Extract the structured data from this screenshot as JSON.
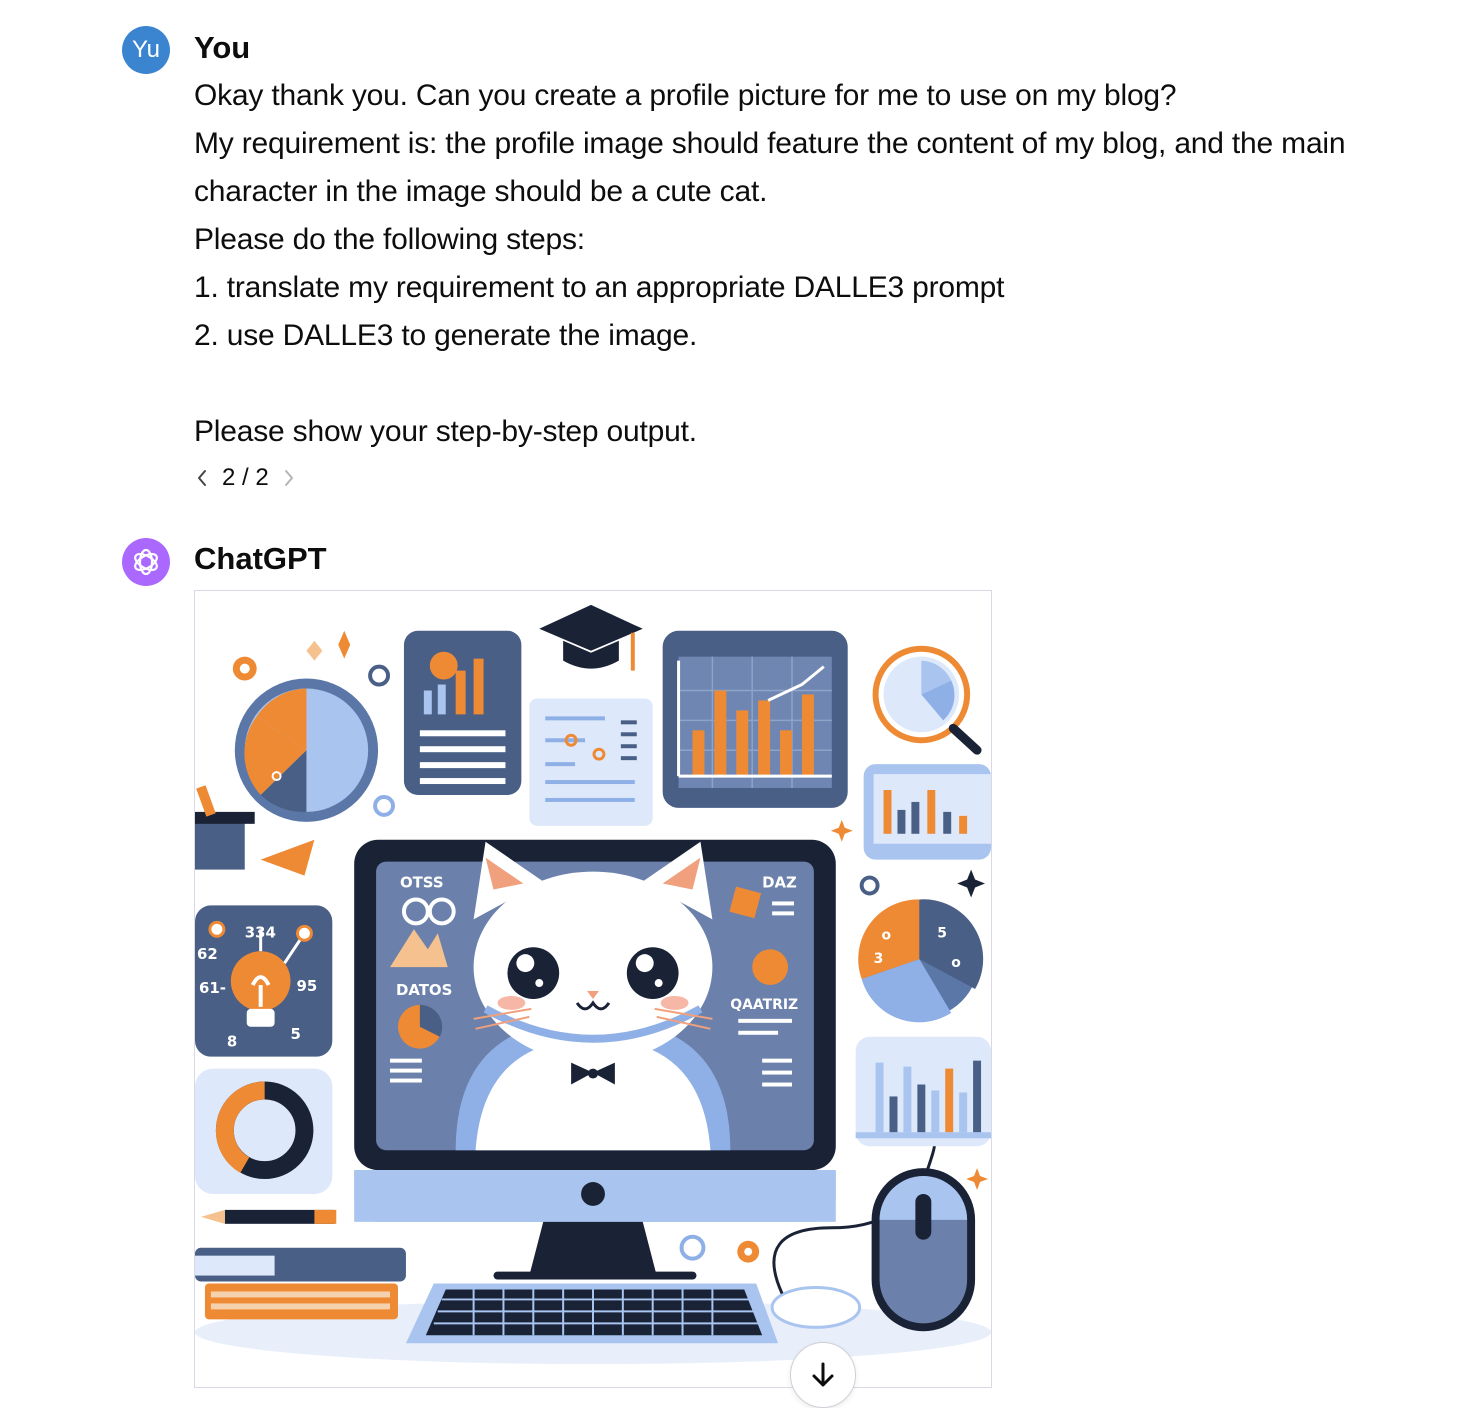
{
  "user": {
    "avatar_initials": "Yu",
    "name": "You",
    "message_lines": [
      "Okay thank you. Can you create a profile picture for me to use on my blog?",
      "My requirement is: the profile image should feature the content of my blog, and the main",
      "character in the image should be a cute cat.",
      "Please do the following steps:",
      "1. translate my requirement to an appropriate DALLE3 prompt",
      "2. use DALLE3 to generate the image.",
      "",
      "Please show your step-by-step output."
    ],
    "pager": "2 / 2"
  },
  "assistant": {
    "name": "ChatGPT",
    "avatar_icon": "openai-logo-icon"
  },
  "image_labels": {
    "left_stats": [
      "334",
      "62",
      "61-",
      "95",
      "8",
      "5"
    ],
    "screen_left_top": "OTSS",
    "screen_left_mid": "DATOS",
    "screen_right_top": "DAZ",
    "screen_right_mid": "QAATRIZ",
    "right_pie": [
      "o",
      "5",
      "3",
      "o"
    ]
  },
  "colors": {
    "user_avatar": "#3b84d0",
    "assistant_avatar": "#ab68ff",
    "navy": "#4a5f86",
    "dark": "#1a2236",
    "orange": "#ef8a34",
    "light_blue": "#a9c6f0",
    "pale_blue": "#dde8fa"
  },
  "scroll_button_icon": "arrow-down-icon"
}
